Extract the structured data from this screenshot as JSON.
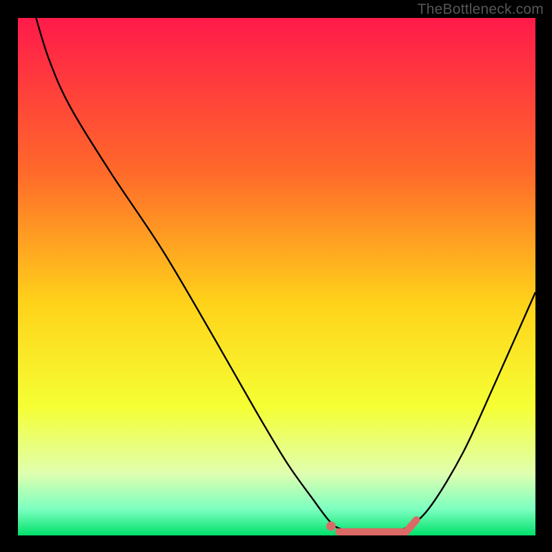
{
  "watermark": "TheBottleneck.com",
  "chart_data": {
    "type": "line",
    "title": "",
    "xlabel": "",
    "ylabel": "",
    "xlim": [
      0,
      100
    ],
    "ylim": [
      0,
      100
    ],
    "gradient_stops": [
      {
        "offset": 0,
        "color": "#ff1a4a"
      },
      {
        "offset": 30,
        "color": "#ff6a2a"
      },
      {
        "offset": 55,
        "color": "#ffd21a"
      },
      {
        "offset": 75,
        "color": "#f5ff33"
      },
      {
        "offset": 88,
        "color": "#e0ffb0"
      },
      {
        "offset": 95,
        "color": "#7affc0"
      },
      {
        "offset": 100,
        "color": "#00e06a"
      }
    ],
    "series": [
      {
        "name": "bottleneck-curve",
        "color": "#000000",
        "points": [
          {
            "x": 3.5,
            "y": 100
          },
          {
            "x": 6,
            "y": 92
          },
          {
            "x": 10,
            "y": 83
          },
          {
            "x": 18,
            "y": 70
          },
          {
            "x": 28,
            "y": 55
          },
          {
            "x": 38,
            "y": 38
          },
          {
            "x": 46,
            "y": 24
          },
          {
            "x": 52,
            "y": 14
          },
          {
            "x": 57,
            "y": 7
          },
          {
            "x": 60,
            "y": 3
          },
          {
            "x": 62,
            "y": 1.4
          },
          {
            "x": 66,
            "y": 0.8
          },
          {
            "x": 72,
            "y": 0.8
          },
          {
            "x": 76,
            "y": 2
          },
          {
            "x": 80,
            "y": 6
          },
          {
            "x": 86,
            "y": 16
          },
          {
            "x": 92,
            "y": 29
          },
          {
            "x": 100,
            "y": 47
          }
        ]
      }
    ],
    "optimum_marker": {
      "color": "#db6a66",
      "dot": {
        "x": 60.5,
        "y": 1.8,
        "r": 0.9
      },
      "bar_start": {
        "x": 62,
        "y": 0.7
      },
      "bar_end": {
        "x": 75,
        "y": 0.7
      },
      "bar_thickness": 1.4,
      "tail_end": {
        "x": 77,
        "y": 3
      }
    }
  }
}
